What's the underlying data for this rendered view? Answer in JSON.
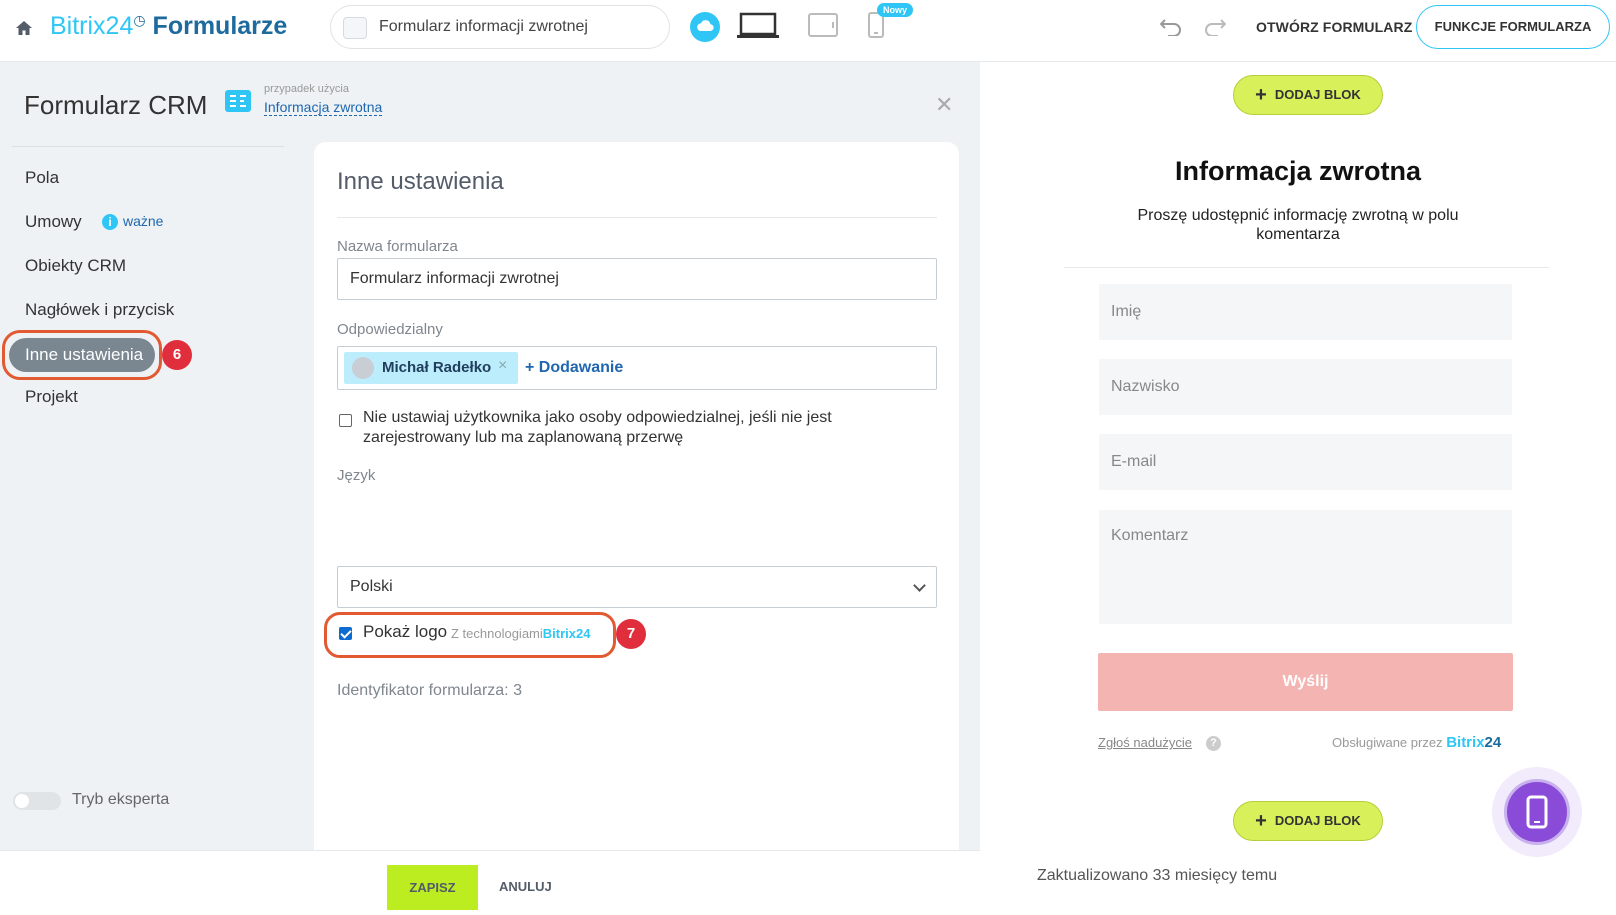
{
  "topbar": {
    "brand_b24": "Bitrix24",
    "brand_form": "Formularze",
    "form_title": "Formularz informacji zwrotnej",
    "new_badge": "Nowy",
    "open_form": "OTWÓRZ FORMULARZ",
    "form_functions": "FUNKCJE FORMULARZA"
  },
  "sidebar": {
    "title": "Formularz CRM",
    "usecase_small": "przypadek użycia",
    "usecase_link": "Informacja zwrotna",
    "items": [
      {
        "label": "Pola"
      },
      {
        "label": "Umowy"
      },
      {
        "label": "Obiekty CRM"
      },
      {
        "label": "Nagłówek i przycisk"
      },
      {
        "label": "Inne ustawienia"
      },
      {
        "label": "Projekt"
      }
    ],
    "important_label": "ważne",
    "expert_mode": "Tryb eksperta"
  },
  "markers": {
    "m6": "6",
    "m7": "7"
  },
  "settings": {
    "heading": "Inne ustawienia",
    "name_label": "Nazwa formularza",
    "name_value": "Formularz informacji zwrotnej",
    "responsible_label": "Odpowiedzialny",
    "responsible_user": "Michał Radełko",
    "add_label": "Dodawanie",
    "no_user_checkbox": "Nie ustawiaj użytkownika jako osoby odpowiedzialnej, jeśli nie jest zarejestrowany lub ma zaplanowaną przerwę",
    "language_label": "Język",
    "language_value": "Polski",
    "show_logo_label": "Pokaż logo",
    "show_logo_tech": "Z technologiami",
    "show_logo_brand": "Bitrix24",
    "form_id": "Identyfikator formularza: 3"
  },
  "bottom": {
    "save": "ZAPISZ",
    "cancel": "ANULUJ"
  },
  "preview": {
    "add_block": "DODAJ BLOK",
    "title": "Informacja zwrotna",
    "subtitle": "Proszę udostępnić informację zwrotną w polu komentarza",
    "fields": [
      "Imię",
      "Nazwisko",
      "E-mail",
      "Komentarz"
    ],
    "send": "Wyślij",
    "report_abuse": "Zgłoś nadużycie",
    "powered_by": "Obsługiwane przez",
    "powered_brand": "Bitrix",
    "powered_brand_num": "24",
    "updated": "Zaktualizowano 33 miesięcy temu"
  },
  "colors": {
    "accent": "#2fc6f6",
    "save": "#bbed21",
    "marker": "#e12e3c",
    "send": "#f4b4b1"
  }
}
